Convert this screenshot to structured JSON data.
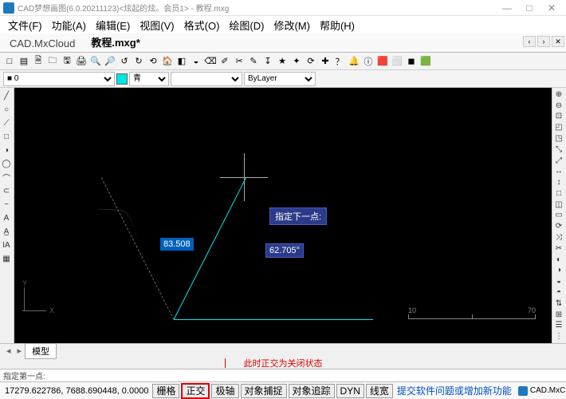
{
  "title": "CAD梦想画图(6.0.20211123)<炫起的炫。会员1> - 教程.mxg",
  "window_controls": {
    "min": "—",
    "max": "□",
    "close": "✕"
  },
  "menu": [
    "文件(F)",
    "功能(A)",
    "编辑(E)",
    "视图(V)",
    "格式(O)",
    "绘图(D)",
    "修改(M)",
    "帮助(H)"
  ],
  "tabs": {
    "cloud": "CAD.MxCloud",
    "doc": "教程.mxg*",
    "ctrls": [
      "‹",
      "›",
      "✕"
    ]
  },
  "toolbar1_icons": [
    "□",
    "▤",
    "🗎",
    "🗀",
    "🖫",
    "🖨",
    "🔍",
    "🔎",
    "↺",
    "↻",
    "⟲",
    "🏠",
    "◧",
    "◒",
    "⌫",
    "✐",
    "✂",
    "✎",
    "↧",
    "★",
    "✦",
    "⟳",
    "✚",
    "？",
    "🔔",
    "ⓘ",
    "🟥",
    "⬜",
    "◼",
    "🟩"
  ],
  "toolbar2": {
    "layer_sel": "■ 0",
    "color_sel": "青",
    "lt_sel": "",
    "ltwt_sel": "ByLayer",
    "color_swatch": "#00e5e5"
  },
  "left_tools": [
    "╱",
    "○",
    "⟋",
    "□",
    "◑",
    "◯",
    "⌒",
    "⊂",
    "~",
    "A",
    "A̲",
    "IA",
    "▦"
  ],
  "right_tools": [
    "⊕",
    "⊖",
    "⊡",
    "◰",
    "◳",
    "⤡",
    "⤢",
    "↔",
    "↕",
    "□",
    "◫",
    "▭",
    "⟳",
    "⤨",
    "✂",
    "◐",
    "◑",
    "◒",
    "◓",
    "⇅",
    "⊞",
    "☰",
    "⋮"
  ],
  "canvas": {
    "prompt": "指定下一点:",
    "dim_len": "83.508",
    "dim_ang": "62.705°",
    "ruler_left": "10",
    "ruler_right": "70",
    "ucs_y": "Y",
    "ucs_x": "X"
  },
  "model_tab": "模型",
  "annotation": "此时正交为关闭状态",
  "command_prompt": "指定第一点:",
  "status": {
    "coord": "17279.622786, 7688.690448, 0.0000",
    "toggles": [
      "栅格",
      "正交",
      "极轴",
      "对象捕捉",
      "对象追踪",
      "DYN",
      "线宽"
    ],
    "highlight_index": 1,
    "link": "提交软件问题或增加新功能",
    "logo": "CAD.MxCloud"
  }
}
